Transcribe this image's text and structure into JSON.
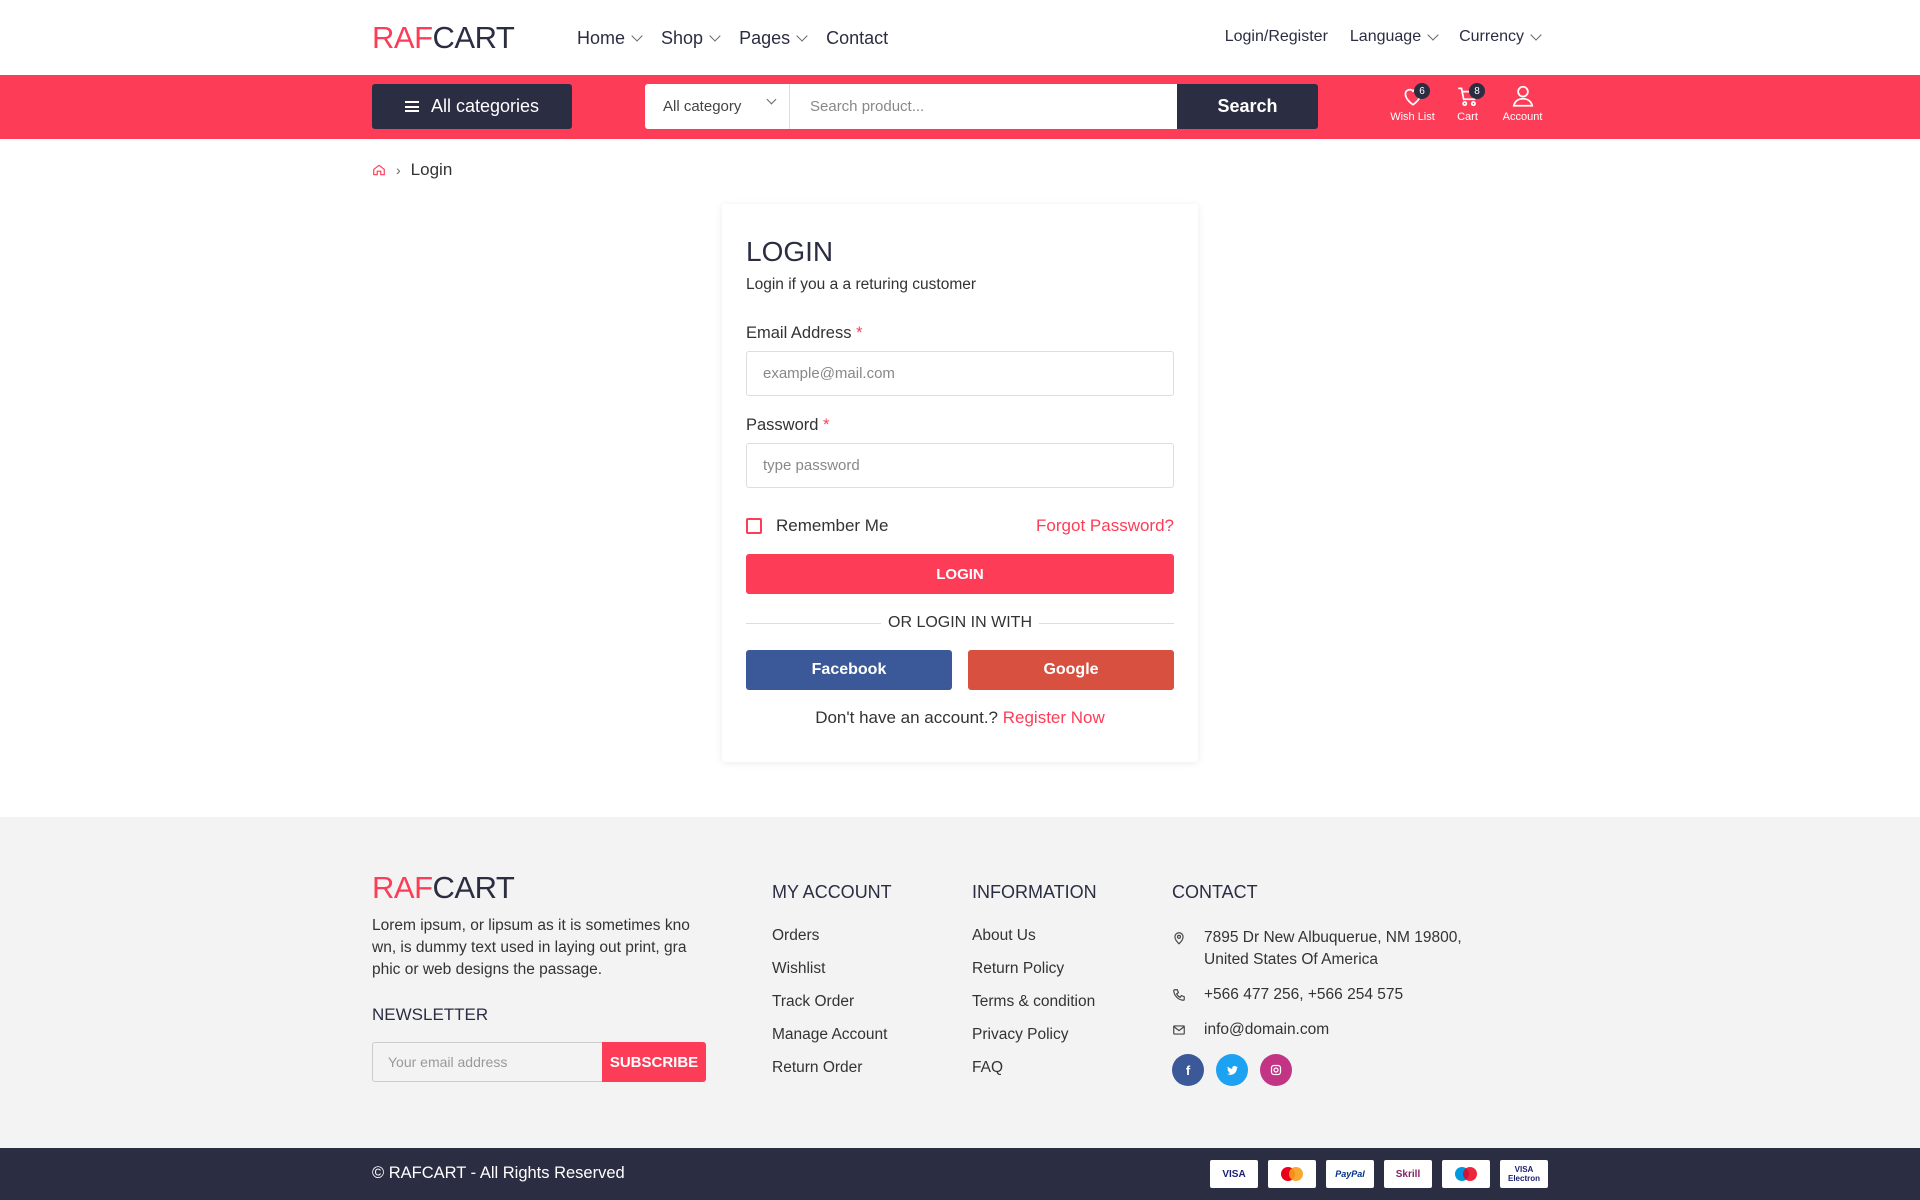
{
  "brand": {
    "part1": "RAF",
    "part2": "CART"
  },
  "nav": {
    "items": [
      "Home",
      "Shop",
      "Pages",
      "Contact"
    ],
    "login_register": "Login/Register",
    "language": "Language",
    "currency": "Currency"
  },
  "searchbar": {
    "all_categories": "All categories",
    "category_select": "All category",
    "placeholder": "Search product...",
    "button": "Search"
  },
  "header_icons": {
    "wishlist": {
      "label": "Wish List",
      "count": "6"
    },
    "cart": {
      "label": "Cart",
      "count": "8"
    },
    "account": {
      "label": "Account"
    }
  },
  "breadcrumb": {
    "current": "Login"
  },
  "login": {
    "title": "LOGIN",
    "subtitle": "Login if you a a returing customer",
    "email_label": "Email Address",
    "email_placeholder": "example@mail.com",
    "password_label": "Password",
    "password_placeholder": "type password",
    "required_mark": "*",
    "remember": "Remember Me",
    "forgot": "Forgot Password?",
    "submit": "LOGIN",
    "or_text": "OR LOGIN IN WITH",
    "facebook": "Facebook",
    "google": "Google",
    "no_account": "Don't have an account.?",
    "register": "Register Now"
  },
  "footer": {
    "description": "Lorem ipsum, or lipsum as it is sometimes kno wn, is dummy text used in laying out print, gra phic or web designs the passage.",
    "newsletter_title": "NEWSLETTER",
    "newsletter_placeholder": "Your email address",
    "subscribe": "SUBSCRIBE",
    "my_account": {
      "title": "MY ACCOUNT",
      "links": [
        "Orders",
        "Wishlist",
        "Track Order",
        "Manage Account",
        "Return Order"
      ]
    },
    "information": {
      "title": "INFORMATION",
      "links": [
        "About Us",
        "Return Policy",
        "Terms & condition",
        "Privacy Policy",
        "FAQ"
      ]
    },
    "contact": {
      "title": "CONTACT",
      "address": "7895 Dr New Albuquerue, NM 19800, United States Of America",
      "phone": "+566 477 256, +566 254 575",
      "email": "info@domain.com"
    },
    "copyright": "© RAFCART - All Rights Reserved",
    "payments": [
      "VISA",
      "MasterCard",
      "PayPal",
      "Skrill",
      "Maestro",
      "VISA Electron"
    ]
  },
  "colors": {
    "accent": "#fd3d57",
    "dark": "#2b2d42",
    "facebook": "#3b5999",
    "google": "#d85040"
  }
}
